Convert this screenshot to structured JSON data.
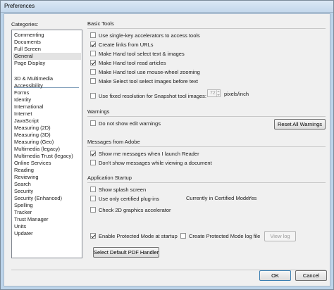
{
  "window": {
    "title": "Preferences"
  },
  "categories": {
    "label": "Categories:",
    "items": [
      "Commenting",
      "Documents",
      "Full Screen",
      "General",
      "Page Display",
      "3D & Multimedia",
      "Accessibility",
      "Forms",
      "Identity",
      "International",
      "Internet",
      "JavaScript",
      "Measuring (2D)",
      "Measuring (3D)",
      "Measuring (Geo)",
      "Multimedia (legacy)",
      "Multimedia Trust (legacy)",
      "Online Services",
      "Reading",
      "Reviewing",
      "Search",
      "Security",
      "Security (Enhanced)",
      "Spelling",
      "Tracker",
      "Trust Manager",
      "Units",
      "Updater"
    ],
    "selected": "General"
  },
  "basic_tools": {
    "title": "Basic Tools",
    "options": [
      {
        "label": "Use single-key accelerators to access tools",
        "checked": false
      },
      {
        "label": "Create links from URLs",
        "checked": true
      },
      {
        "label": "Make Hand tool select text & images",
        "checked": false
      },
      {
        "label": "Make Hand tool read articles",
        "checked": true
      },
      {
        "label": "Make Hand tool use mouse-wheel zooming",
        "checked": false
      },
      {
        "label": "Make Select tool select images before text",
        "checked": false
      }
    ],
    "snapshot": {
      "label": "Use fixed resolution for Snapshot tool images:",
      "checked": false,
      "value": "72",
      "unit": "pixels/inch"
    }
  },
  "warnings": {
    "title": "Warnings",
    "option": {
      "label": "Do not show edit warnings",
      "checked": false
    },
    "reset_button": "Reset All Warnings"
  },
  "messages": {
    "title": "Messages from Adobe",
    "options": [
      {
        "label": "Show me messages when I launch Reader",
        "checked": true
      },
      {
        "label": "Don't show messages while viewing a document",
        "checked": false
      }
    ]
  },
  "startup": {
    "title": "Application Startup",
    "splash": {
      "label": "Show splash screen",
      "checked": false
    },
    "certified": {
      "label": "Use only certified plug-ins",
      "checked": false
    },
    "certified_mode_label": "Currently in Certified Mode:",
    "certified_mode_value": "Yes",
    "graphics": {
      "label": "Check 2D graphics accelerator",
      "checked": false
    }
  },
  "protected": {
    "enable": {
      "label": "Enable Protected Mode at startup",
      "checked": true
    },
    "logfile": {
      "label": "Create Protected Mode log file",
      "checked": false
    },
    "view_log_button": "View log",
    "pdf_handler_button": "Select Default PDF Handler"
  },
  "dialog": {
    "ok": "OK",
    "cancel": "Cancel"
  }
}
